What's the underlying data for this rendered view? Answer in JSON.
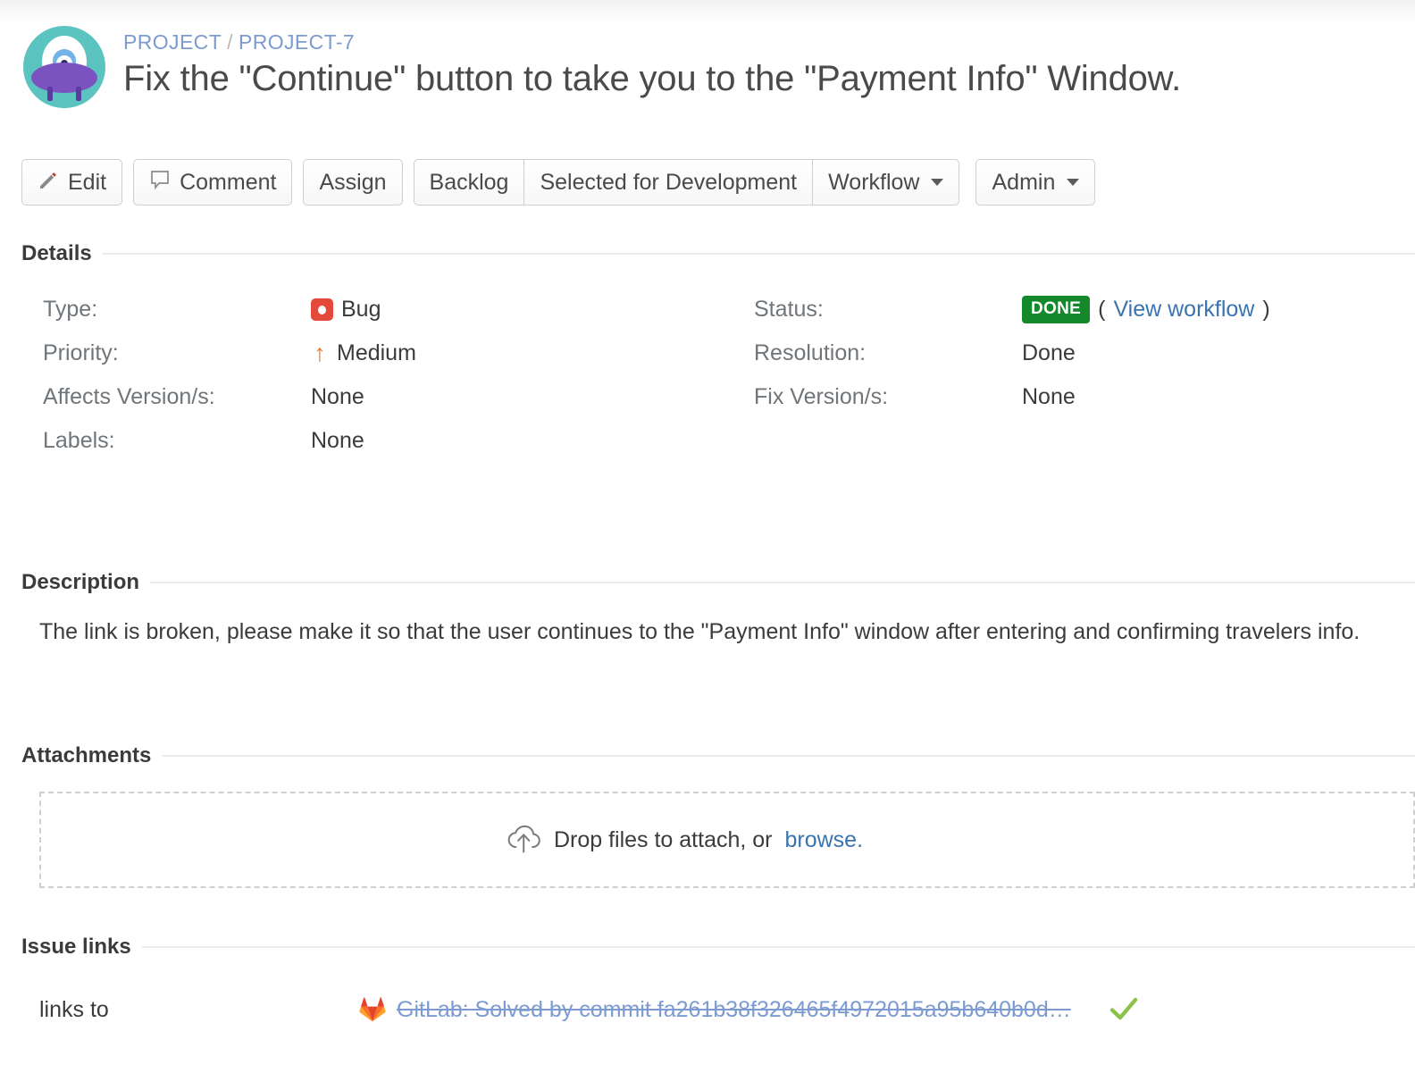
{
  "header": {
    "avatar_icon": "ufo-avatar-icon",
    "breadcrumb": {
      "project": "PROJECT",
      "separator": "/",
      "issue_key": "PROJECT-7"
    },
    "title": "Fix the \"Continue\" button to take you to the \"Payment Info\" Window."
  },
  "toolbar": {
    "edit_label": "Edit",
    "comment_label": "Comment",
    "assign_label": "Assign",
    "backlog_label": "Backlog",
    "selected_for_development_label": "Selected for Development",
    "workflow_label": "Workflow",
    "admin_label": "Admin"
  },
  "details": {
    "section_title": "Details",
    "left_fields": [
      {
        "label": "Type:",
        "value": "Bug",
        "icon": "bug-icon"
      },
      {
        "label": "Priority:",
        "value": "Medium",
        "icon": "priority-medium-arrow-icon"
      },
      {
        "label": "Affects Version/s:",
        "value": "None",
        "icon": ""
      },
      {
        "label": "Labels:",
        "value": "None",
        "icon": ""
      }
    ],
    "right_fields": [
      {
        "label": "Status:",
        "value": "DONE",
        "link_text": "View workflow",
        "open_paren": "(",
        "close_paren": ")"
      },
      {
        "label": "Resolution:",
        "value": "Done"
      },
      {
        "label": "Fix Version/s:",
        "value": "None"
      }
    ],
    "status_color": "#14892c"
  },
  "description": {
    "section_title": "Description",
    "text": "The link is broken, please make it so that the user continues to the \"Payment Info\" window after entering and confirming travelers info."
  },
  "attachments": {
    "section_title": "Attachments",
    "dropzone_icon": "cloud-upload-icon",
    "dropzone_text": "Drop files to attach, or",
    "browse_label": "browse."
  },
  "issue_links": {
    "section_title": "Issue links",
    "rows": [
      {
        "relation": "links to",
        "provider_icon": "gitlab-icon",
        "summary": "GitLab: Solved by commit fa261b38f326465f4972015a95b640b0d…",
        "status_icon": "green-check-icon"
      }
    ]
  }
}
